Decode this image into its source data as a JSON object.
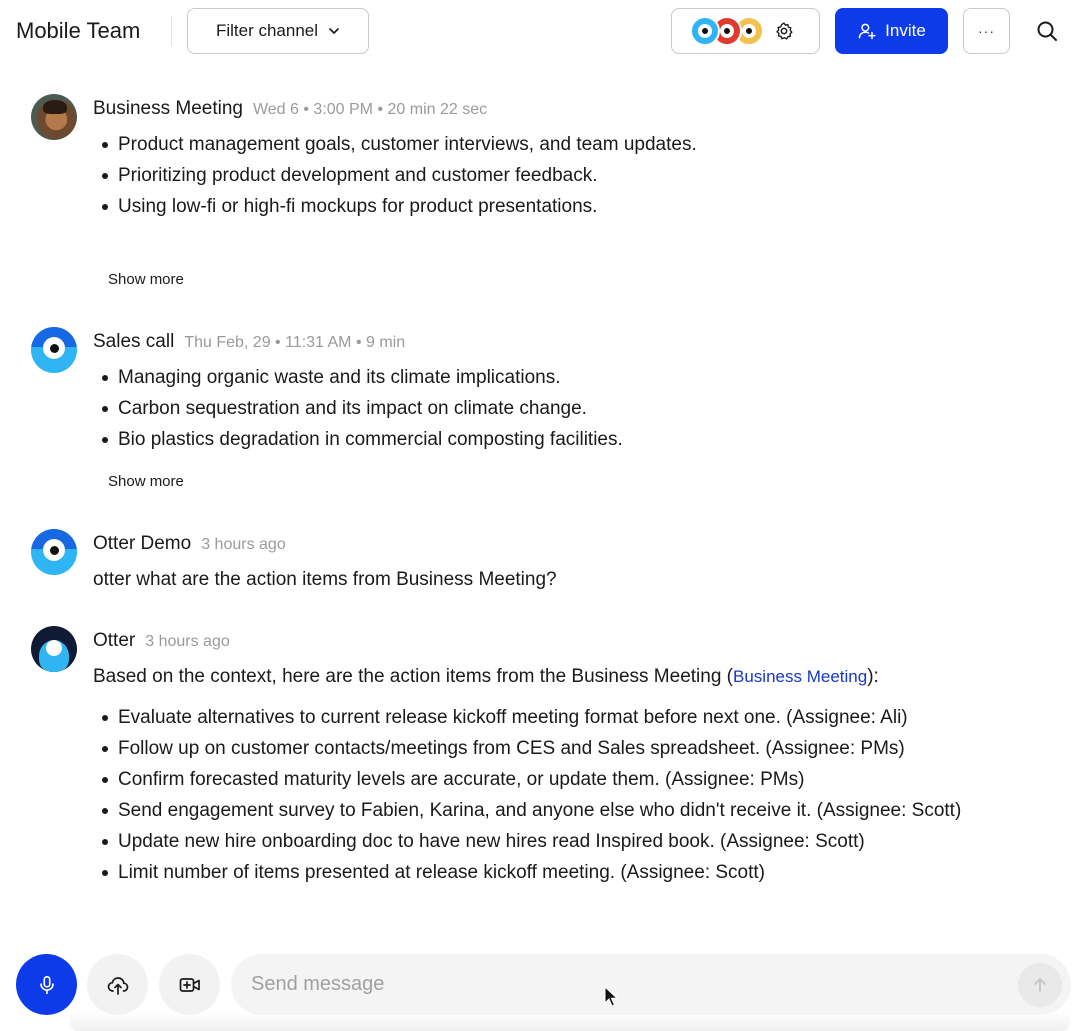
{
  "header": {
    "title": "Mobile Team",
    "filter_label": "Filter channel",
    "invite_label": "Invite",
    "more_label": "···",
    "member_avatar_colors": [
      "#2fb5f3",
      "#e03a2e",
      "#f2c14e"
    ]
  },
  "messages": [
    {
      "sender": "Business Meeting",
      "meta": "Wed 6 • 3:00 PM • 20 min 22 sec",
      "bullets": [
        "Product management goals, customer interviews, and team updates.",
        "Prioritizing product development and customer feedback.",
        "Using low-fi or high-fi mockups for product presentations."
      ],
      "show_more": "Show more"
    },
    {
      "sender": "Sales call",
      "meta": "Thu Feb, 29 • 11:31 AM • 9 min",
      "bullets": [
        "Managing organic waste and its climate implications.",
        "Carbon sequestration and its impact on climate change.",
        "Bio plastics degradation in commercial composting facilities."
      ],
      "show_more": "Show more"
    },
    {
      "sender": "Otter Demo",
      "meta": "3 hours ago",
      "text": "otter what are the action items from Business Meeting?"
    },
    {
      "sender": "Otter",
      "meta": "3 hours ago",
      "text_before": "Based on the context, here are the action items from the Business Meeting (",
      "link": "Business Meeting",
      "text_after": "):",
      "bullets": [
        "Evaluate alternatives to current release kickoff meeting format before next one. (Assignee: Ali)",
        "Follow up on customer contacts/meetings from CES and Sales spreadsheet. (Assignee: PMs)",
        "Confirm forecasted maturity levels are accurate, or update them. (Assignee: PMs)",
        "Send engagement survey to Fabien, Karina, and anyone else who didn't receive it. (Assignee: Scott)",
        "Update new hire onboarding doc to have new hires read Inspired book. (Assignee: Scott)",
        "Limit number of items presented at release kickoff meeting. (Assignee: Scott)"
      ]
    }
  ],
  "composer": {
    "placeholder": "Send message"
  },
  "colors": {
    "accent": "#0d3bea",
    "link": "#1538c9",
    "meta": "#9a9a9a"
  }
}
